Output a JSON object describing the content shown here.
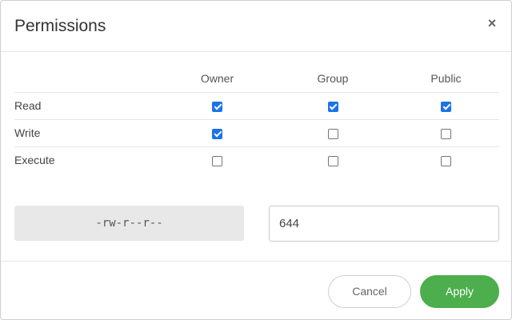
{
  "dialog": {
    "title": "Permissions",
    "close_label": "×"
  },
  "table": {
    "columns": [
      "Owner",
      "Group",
      "Public"
    ],
    "rows": [
      {
        "label": "Read",
        "owner": true,
        "group": true,
        "public": true
      },
      {
        "label": "Write",
        "owner": true,
        "group": false,
        "public": false
      },
      {
        "label": "Execute",
        "owner": false,
        "group": false,
        "public": false
      }
    ]
  },
  "symbolic": "-rw-r--r--",
  "octal": {
    "value": "644"
  },
  "footer": {
    "cancel_label": "Cancel",
    "apply_label": "Apply"
  },
  "colors": {
    "accent": "#1a73e8",
    "apply": "#4cae4c",
    "symbolic_bg": "#e8e8e8"
  }
}
